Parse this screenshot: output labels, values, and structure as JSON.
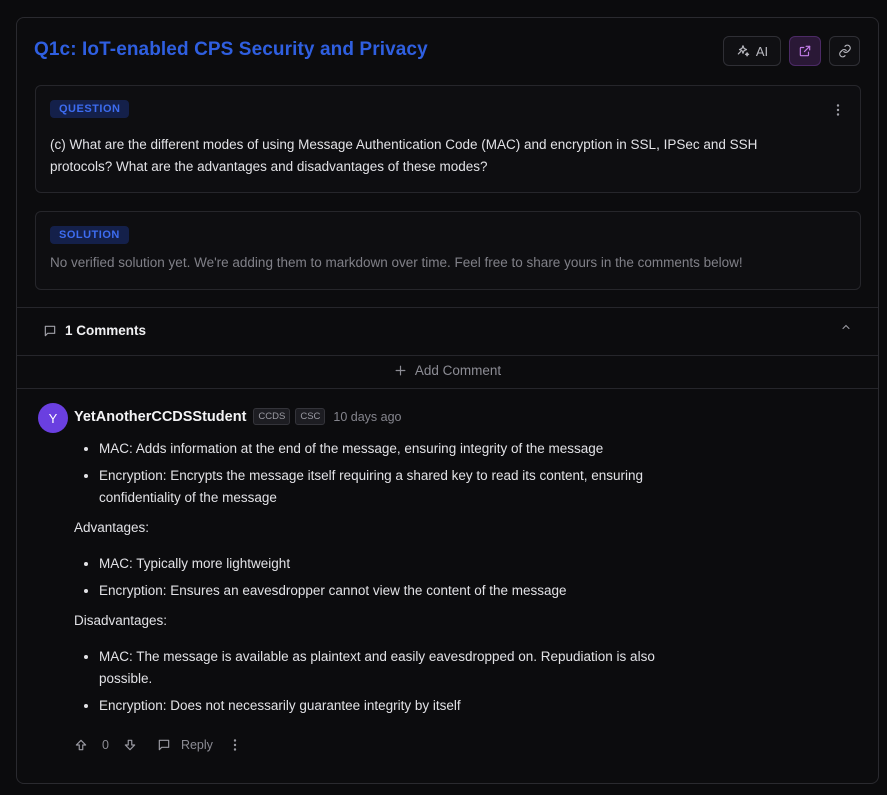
{
  "question": {
    "title": "Q1c: IoT-enabled CPS Security and Privacy",
    "tag": "QUESTION",
    "text": "(c) What are the different modes of using Message Authentication Code (MAC) and encryption in SSL, IPSec and SSH protocols? What are the advantages and disadvantages of these modes?"
  },
  "header_buttons": {
    "ai_label": "AI"
  },
  "solution": {
    "tag": "SOLUTION",
    "text": "No verified solution yet. We're adding them to markdown over time. Feel free to share yours in the comments below!"
  },
  "comments": {
    "count_label": "1 Comments",
    "add_label": "Add Comment",
    "items": [
      {
        "avatar_letter": "Y",
        "author": "YetAnotherCCDSStudent",
        "badges": [
          "CCDS",
          "CSC"
        ],
        "time": "10 days ago",
        "list1": [
          "MAC: Adds information at the end of the message, ensuring integrity of the message",
          "Encryption: Encrypts the message itself requiring a shared key to read its content, ensuring confidentiality of the message"
        ],
        "advantages_label": "Advantages:",
        "advantages": [
          "MAC: Typically more lightweight",
          "Encryption: Ensures an eavesdropper cannot view the content of the message"
        ],
        "disadvantages_label": "Disadvantages:",
        "disadvantages": [
          "MAC: The message is available as plaintext and easily eavesdropped on. Repudiation is also possible.",
          "Encryption: Does not necessarily guarantee integrity by itself"
        ],
        "votes": "0",
        "reply_label": "Reply"
      }
    ]
  },
  "colors": {
    "accent": "#2f5fe0",
    "avatar": "#6a3fe0",
    "open_button": "#c27ce8"
  },
  "icons": [
    "sparkles-icon",
    "external-link-icon",
    "link-icon",
    "more-vertical-icon",
    "comment-icon",
    "chevron-up-icon",
    "plus-icon",
    "upvote-icon",
    "downvote-icon",
    "reply-icon"
  ]
}
